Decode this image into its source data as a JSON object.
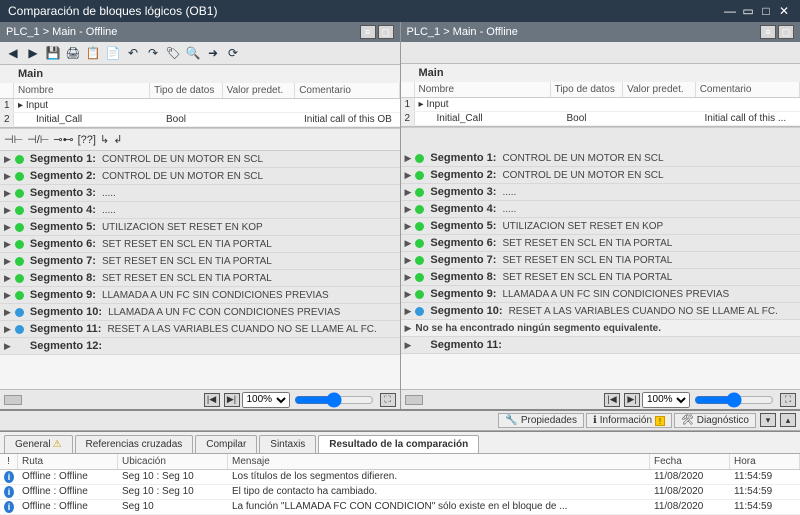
{
  "window": {
    "title": "Comparación de bloques lógicos (OB1)"
  },
  "breadcrumb": "PLC_1 > Main - Offline",
  "block": {
    "main_label": "Main",
    "columns": {
      "name": "Nombre",
      "type": "Tipo de datos",
      "default": "Valor predet.",
      "comment": "Comentario"
    },
    "rows": [
      {
        "name": "Input",
        "type": "",
        "def": "",
        "com": ""
      },
      {
        "name": "Initial_Call",
        "type": "Bool",
        "def": "",
        "com_left": "Initial call of this OB",
        "com_right": "Initial call of this ..."
      }
    ]
  },
  "segments_left": [
    {
      "num": "1",
      "status": "green",
      "title": "Segmento 1:",
      "desc": "CONTROL DE UN MOTOR EN SCL"
    },
    {
      "num": "2",
      "status": "green",
      "title": "Segmento 2:",
      "desc": "CONTROL DE UN MOTOR EN SCL"
    },
    {
      "num": "3",
      "status": "green",
      "title": "Segmento 3:",
      "desc": "....."
    },
    {
      "num": "4",
      "status": "green",
      "title": "Segmento 4:",
      "desc": "....."
    },
    {
      "num": "5",
      "status": "green",
      "title": "Segmento 5:",
      "desc": "UTILIZACIÓN SET RESET EN    KOP"
    },
    {
      "num": "6",
      "status": "green",
      "title": "Segmento 6:",
      "desc": "SET RESET EN SCL EN TIA PORTAL"
    },
    {
      "num": "7",
      "status": "green",
      "title": "Segmento 7:",
      "desc": "SET RESET EN SCL EN TIA PORTAL"
    },
    {
      "num": "8",
      "status": "green",
      "title": "Segmento 8:",
      "desc": "SET RESET EN SCL EN TIA PORTAL"
    },
    {
      "num": "9",
      "status": "green",
      "title": "Segmento 9:",
      "desc": "LLAMADA A UN FC SIN CONDICIONES PREVIAS"
    },
    {
      "num": "10",
      "status": "blue",
      "title": "Segmento 10:",
      "desc": "LLAMADA A UN FC CON CONDICIONES PREVIAS"
    },
    {
      "num": "11",
      "status": "blue",
      "title": "Segmento 11:",
      "desc": "RESET A LAS VARIABLES CUANDO NO SE LLAME AL FC."
    },
    {
      "num": "12",
      "status": "none",
      "title": "Segmento 12:",
      "desc": ""
    }
  ],
  "segments_right": [
    {
      "num": "1",
      "status": "green",
      "title": "Segmento 1:",
      "desc": "CONTROL DE UN MOTOR EN SCL"
    },
    {
      "num": "2",
      "status": "green",
      "title": "Segmento 2:",
      "desc": "CONTROL DE UN MOTOR EN SCL"
    },
    {
      "num": "3",
      "status": "green",
      "title": "Segmento 3:",
      "desc": "....."
    },
    {
      "num": "4",
      "status": "green",
      "title": "Segmento 4:",
      "desc": "....."
    },
    {
      "num": "5",
      "status": "green",
      "title": "Segmento 5:",
      "desc": "UTILIZACIÓN SET RESET EN    KOP"
    },
    {
      "num": "6",
      "status": "green",
      "title": "Segmento 6:",
      "desc": "SET RESET EN SCL EN TIA PORTAL"
    },
    {
      "num": "7",
      "status": "green",
      "title": "Segmento 7:",
      "desc": "SET RESET EN SCL EN TIA PORTAL"
    },
    {
      "num": "8",
      "status": "green",
      "title": "Segmento 8:",
      "desc": "SET RESET EN SCL EN TIA PORTAL"
    },
    {
      "num": "9",
      "status": "green",
      "title": "Segmento 9:",
      "desc": "LLAMADA A UN FC SIN CONDICIONES PREVIAS"
    },
    {
      "num": "10",
      "status": "blue",
      "title": "Segmento 10:",
      "desc": "RESET A LAS VARIABLES CUANDO NO SE LLAME AL FC."
    },
    {
      "num": "missing",
      "status": "plain",
      "title": "",
      "desc": "No se ha encontrado ningún segmento equivalente."
    },
    {
      "num": "11",
      "status": "none",
      "title": "Segmento 11:",
      "desc": ""
    }
  ],
  "zoom": {
    "value": "100%"
  },
  "right_tabs": {
    "properties": "Propiedades",
    "info": "Información",
    "diagnostics": "Diagnóstico"
  },
  "bottom_tabs": {
    "general": "General",
    "xref": "Referencias cruzadas",
    "compile": "Compilar",
    "syntax": "Sintaxis",
    "result": "Resultado de la comparación"
  },
  "result": {
    "columns": {
      "path": "Ruta",
      "loc": "Ubicación",
      "msg": "Mensaje",
      "date": "Fecha",
      "time": "Hora"
    },
    "rows": [
      {
        "path": "Offline : Offline",
        "loc": "Seg 10 : Seg 10",
        "msg": "Los títulos de los segmentos difieren.",
        "date": "11/08/2020",
        "time": "11:54:59"
      },
      {
        "path": "Offline : Offline",
        "loc": "Seg 10 : Seg 10",
        "msg": "El tipo de contacto ha cambiado.",
        "date": "11/08/2020",
        "time": "11:54:59"
      },
      {
        "path": "Offline : Offline",
        "loc": "Seg 10",
        "msg": "La función \"LLAMADA FC CON CONDICION\" sólo existe en el bloque de ...",
        "date": "11/08/2020",
        "time": "11:54:59"
      }
    ]
  }
}
